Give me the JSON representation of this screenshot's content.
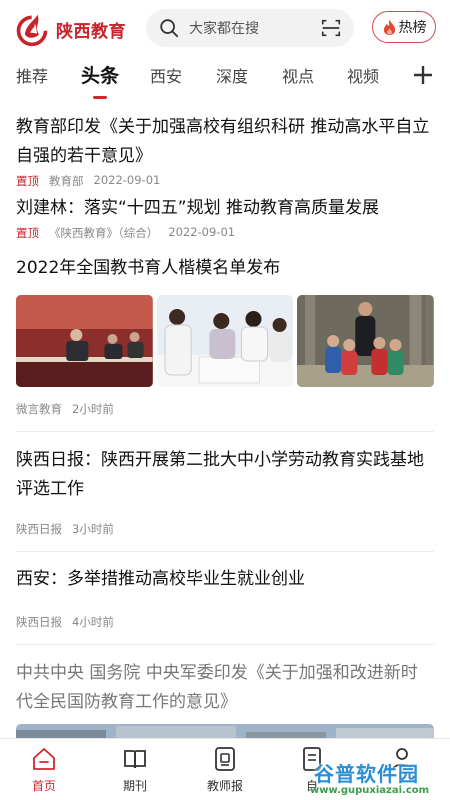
{
  "header": {
    "app_name": "陕西教育",
    "search_placeholder": "大家都在搜",
    "hot_label": "热榜"
  },
  "tabs": [
    {
      "label": "推荐"
    },
    {
      "label": "头条",
      "active": true
    },
    {
      "label": "西安"
    },
    {
      "label": "深度"
    },
    {
      "label": "视点"
    },
    {
      "label": "视频"
    }
  ],
  "articles": [
    {
      "title": "教育部印发《关于加强高校有组织科研 推动高水平自立自强的若干意见》",
      "tag": "置顶",
      "source": "教育部",
      "date": "2022-09-01"
    },
    {
      "title": "刘建林：落实“十四五”规划  推动教育高质量发展",
      "tag": "置顶",
      "source": "《陕西教育》（综合）",
      "date": "2022-09-01"
    },
    {
      "title": "2022年全国教书育人楷模名单发布",
      "source": "微言教育",
      "time": "2小时前"
    },
    {
      "title": "陕西日报：陕西开展第二批大中小学劳动教育实践基地评选工作",
      "source": "陕西日报",
      "time": "3小时前"
    },
    {
      "title": "西安：多举措推动高校毕业生就业创业",
      "source": "陕西日报",
      "time": "4小时前"
    },
    {
      "title": "中共中央 国务院 中央军委印发《关于加强和改进新时代全民国防教育工作的意见》"
    }
  ],
  "bottom_nav": [
    {
      "label": "首页",
      "icon": "home-icon",
      "active": true
    },
    {
      "label": "期刊",
      "icon": "book-icon"
    },
    {
      "label": "教师报",
      "icon": "newspaper-icon"
    },
    {
      "label": "自",
      "icon": "document-icon"
    },
    {
      "label": "",
      "icon": "user-icon"
    }
  ],
  "watermark": {
    "title": "谷普软件园",
    "url": "www.gupuxiazai.com"
  },
  "colors": {
    "brand_red": "#c8232b",
    "tab_underline": "#d4262e"
  }
}
